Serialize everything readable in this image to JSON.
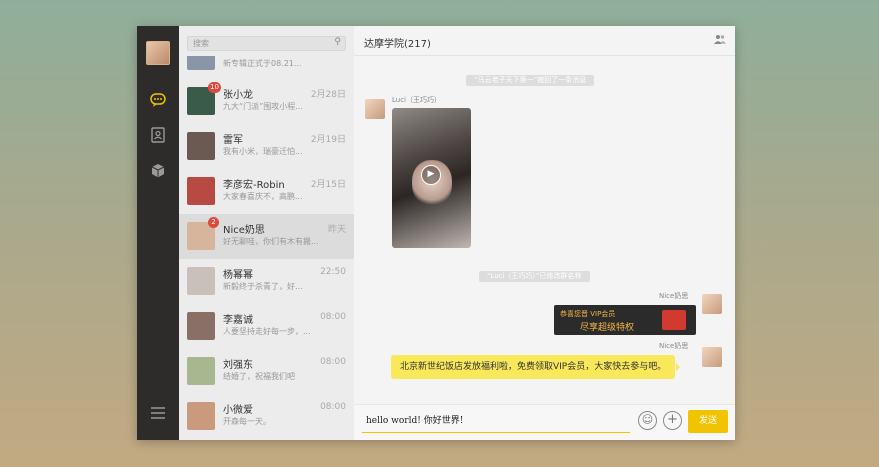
{
  "search": {
    "placeholder": "搜索"
  },
  "partial_item": {
    "preview": "新专辑正式于08.21..."
  },
  "conversations": [
    {
      "name": "张小龙",
      "time": "2月28日",
      "preview": "九大“门派”围攻小程...",
      "badge": "10",
      "color": "#3a5a4a"
    },
    {
      "name": "雷军",
      "time": "2月19日",
      "preview": "我有小米，瑞豪迁怕...",
      "badge": "",
      "color": "#6b5a52"
    },
    {
      "name": "李彦宏-Robin",
      "time": "2月15日",
      "preview": "大家春喜庆不，高鹏...",
      "badge": "",
      "color": "#b84a44"
    },
    {
      "name": "Nice奶思",
      "time": "昨天",
      "preview": "好无聊哇，你们有木有搬...",
      "badge": "2",
      "color": "#d7b59d"
    },
    {
      "name": "杨幂幂",
      "time": "22:50",
      "preview": "新毅终于杀青了，好…",
      "badge": "",
      "color": "#c9c0bc"
    },
    {
      "name": "李嘉诚",
      "time": "08:00",
      "preview": "人要坚持走好每一步，...",
      "badge": "",
      "color": "#8a6f66"
    },
    {
      "name": "刘强东",
      "time": "08:00",
      "preview": "结婚了，祝福我们吧",
      "badge": "",
      "color": "#a7b890"
    },
    {
      "name": "小微爱",
      "time": "08:00",
      "preview": "开森每一天。",
      "badge": "",
      "color": "#c99a7c"
    }
  ],
  "chat": {
    "title": "达摩学院(217)",
    "sys_msg_1": "“马云老子天下第一”撤回了一条消息",
    "sender_1": "Luci（王巧巧）",
    "sys_msg_2": "“Luci（王巧巧）”已修改群名称",
    "sender_2": "Nice奶思",
    "vip_line1": "恭喜您晋 VIP会员",
    "vip_line2": "尽享超级特权",
    "sender_3": "Nice奶思",
    "bubble_text": "北京新世纪饭店发放福利啦，免费领取VIP会员，大家快去参与吧。",
    "input_value": "hello world! 你好世界!",
    "send_label": "发送"
  }
}
